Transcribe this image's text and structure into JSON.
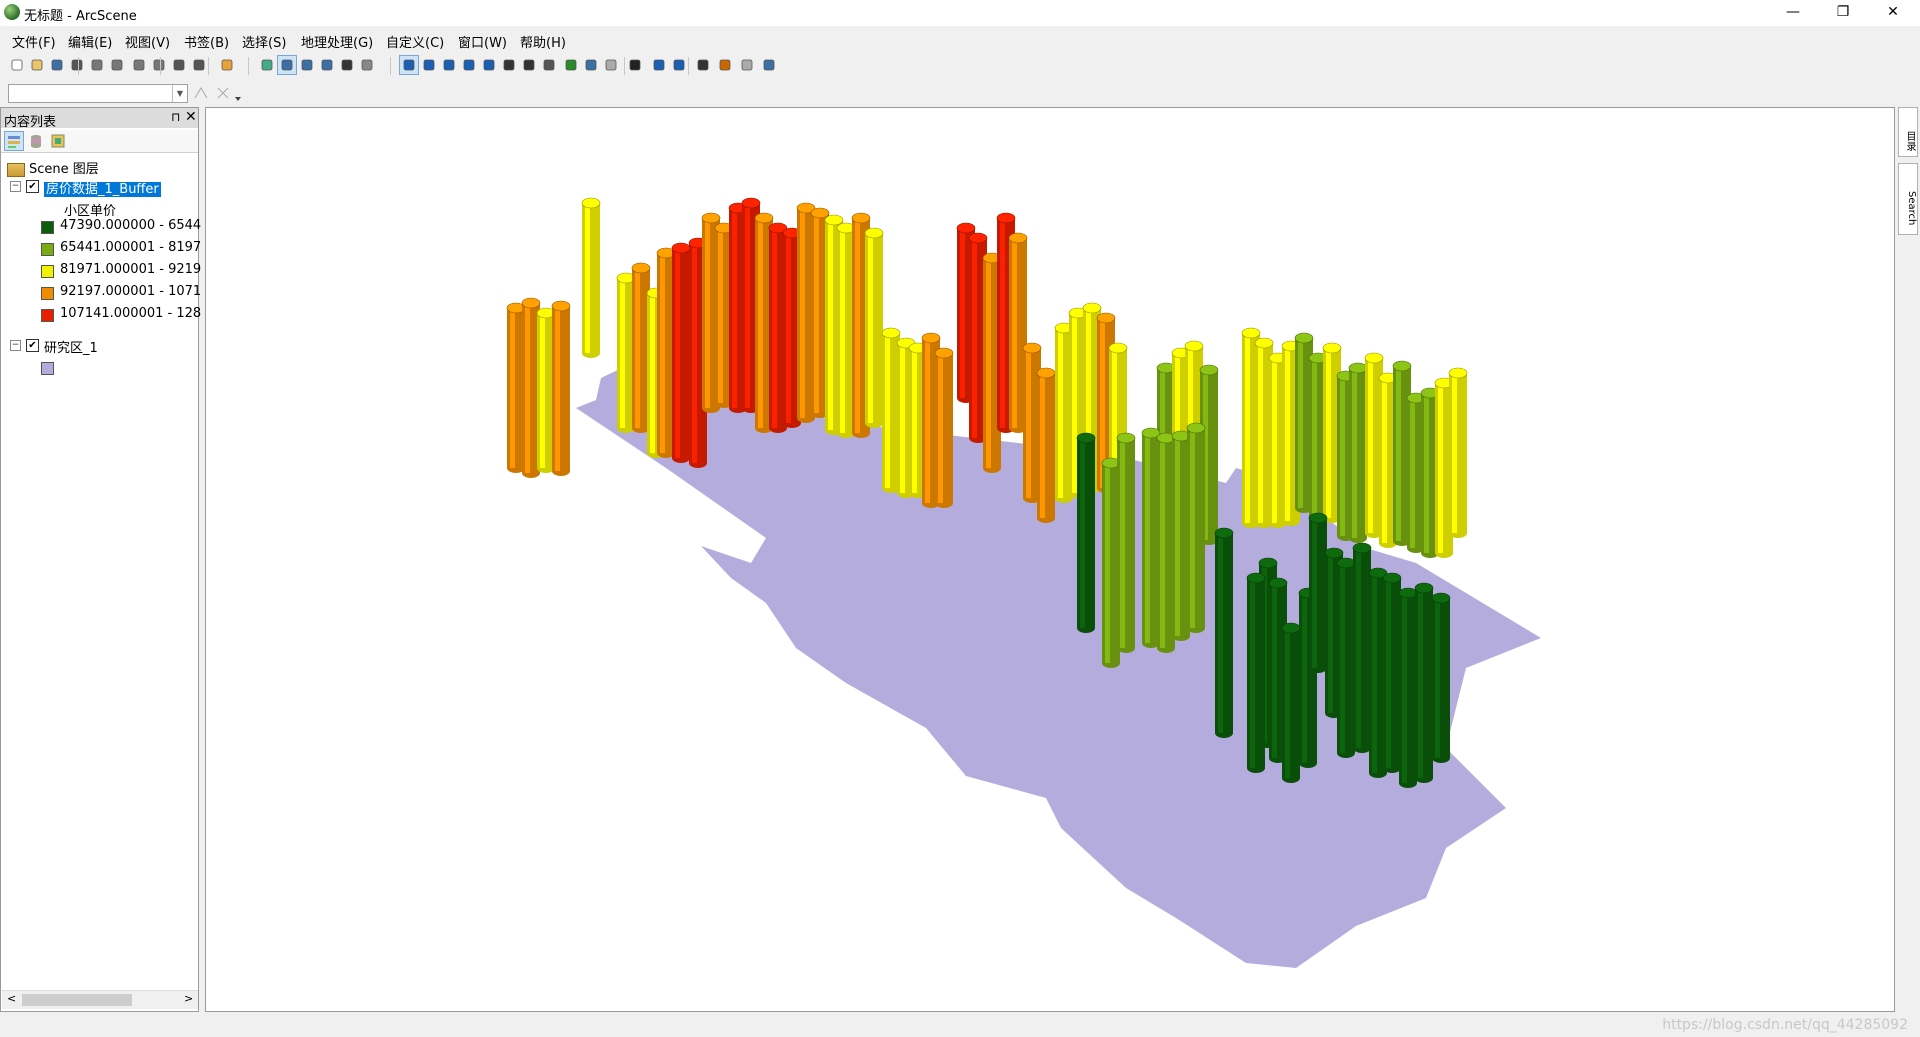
{
  "window": {
    "title": "无标题 - ArcScene",
    "minimize": "—",
    "restore": "❐",
    "close": "✕"
  },
  "menu": [
    "文件(F)",
    "编辑(E)",
    "视图(V)",
    "书签(B)",
    "选择(S)",
    "地理处理(G)",
    "自定义(C)",
    "窗口(W)",
    "帮助(H)"
  ],
  "toolbar": {
    "icons": [
      "new-document-icon",
      "open-folder-icon",
      "save-icon",
      "print-icon",
      "cut-icon",
      "copy-icon",
      "paste-icon",
      "delete-icon",
      "undo-icon",
      "redo-icon",
      "add-data-icon",
      "scene-properties-icon",
      "full-extent-icon",
      "layer-icon",
      "layer2-icon",
      "window-icon",
      "catalog-icon",
      "navigate-icon",
      "fly-icon",
      "center-on-target-icon",
      "zoom-to-target-icon",
      "set-observer-icon",
      "zoom-in-icon",
      "zoom-out-icon",
      "pan-icon",
      "globe-icon",
      "full-view-icon",
      "narrow-fov-icon",
      "select-elements-icon",
      "identify-icon",
      "html-popup-icon",
      "find-icon",
      "measure-icon",
      "animation-icon",
      "3d-effects-icon"
    ],
    "layer_combo_value": ""
  },
  "toc": {
    "title": "内容列表",
    "pin": "ㅁ",
    "close": "✕",
    "scene_label": "Scene 图层",
    "layer1": {
      "name": "房价数据_1_Buffer",
      "checked": true,
      "field": "小区单价",
      "classes": [
        {
          "label": "47390.000000 - 6544",
          "color": "#0b5d0b"
        },
        {
          "label": "65441.000001 - 8197",
          "color": "#7aab12"
        },
        {
          "label": "81971.000001 - 9219",
          "color": "#f2f200"
        },
        {
          "label": "92197.000001 - 1071",
          "color": "#f08c00"
        },
        {
          "label": "107141.000001 - 128",
          "color": "#e81e00"
        }
      ]
    },
    "layer2": {
      "name": "研究区_1",
      "checked": true,
      "color": "#b4acdc"
    },
    "scroll_left": "<",
    "scroll_right": ">"
  },
  "right_dock": {
    "tabs": [
      "目录",
      "Search"
    ]
  },
  "watermark": "https://blog.csdn.net/qq_44285092"
}
